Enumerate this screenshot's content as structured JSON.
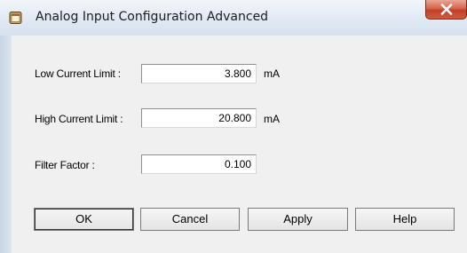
{
  "window": {
    "title": "Analog Input Configuration Advanced",
    "close_glyph": "X"
  },
  "form": {
    "low_current": {
      "label": "Low Current Limit :",
      "value": "3.800",
      "unit": "mA"
    },
    "high_current": {
      "label": "High Current Limit :",
      "value": "20.800",
      "unit": "mA"
    },
    "filter_factor": {
      "label": "Filter Factor :",
      "value": "0.100"
    }
  },
  "buttons": {
    "ok": "OK",
    "cancel": "Cancel",
    "apply": "Apply",
    "help": "Help"
  },
  "colors": {
    "close_button": "#c94a33",
    "dialog_background": "#f0f0f0"
  },
  "icons": {
    "title_icon": "app-window-icon",
    "close_icon": "close-x-icon"
  }
}
